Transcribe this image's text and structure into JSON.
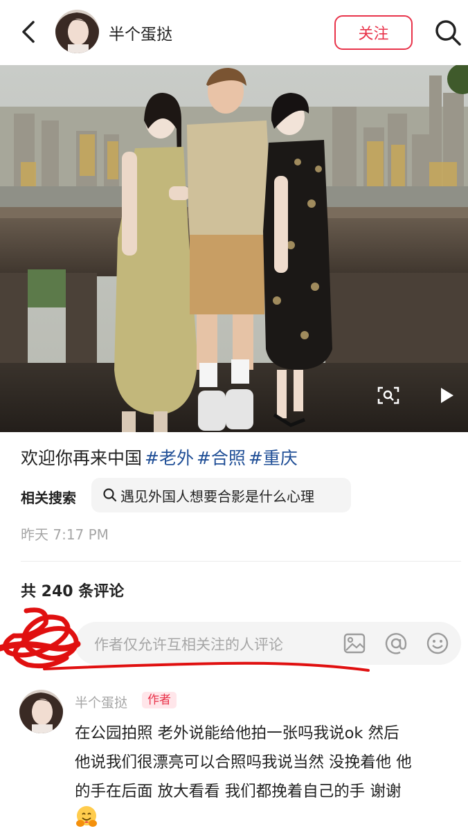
{
  "header": {
    "author_name": "半个蛋挞",
    "follow_label": "关注",
    "icons": [
      "chevron-left-icon",
      "search-icon"
    ]
  },
  "post": {
    "photo_icons": [
      "scan-icon",
      "play-icon"
    ],
    "caption_text": "欢迎你再来中国",
    "hashtags": [
      "#老外",
      "#合照",
      "#重庆"
    ],
    "related_label": "相关搜索",
    "related_query": "遇见外国人想要合影是什么心理",
    "time": "昨天 7:17 PM"
  },
  "comments": {
    "count_label": "共 240 条评论",
    "input_placeholder": "作者仅允许互相关注的人评论",
    "input_icons": [
      "image-icon",
      "at-icon",
      "emoji-icon"
    ],
    "items": [
      {
        "author": "半个蛋挞",
        "badge": "作者",
        "lines": [
          "在公园拍照 老外说能给他拍一张吗我说ok 然后",
          "他说我们很漂亮可以合照吗我说当然 没挽着他 他",
          "的手在后面 放大看看 我们都挽着自己的手 谢谢"
        ],
        "emoji": "hugging-face-emoji"
      }
    ]
  },
  "colors": {
    "accent": "#e8334a",
    "hashtag": "#1f4e96",
    "muted": "#a6a6a6",
    "annotation": "#e01010"
  }
}
